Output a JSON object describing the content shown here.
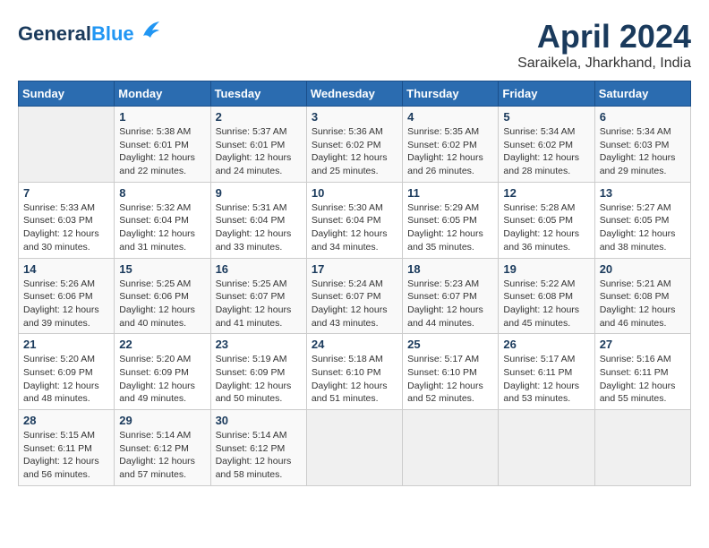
{
  "header": {
    "logo_text_general": "General",
    "logo_text_blue": "Blue",
    "month_year": "April 2024",
    "location": "Saraikela, Jharkhand, India"
  },
  "days_of_week": [
    "Sunday",
    "Monday",
    "Tuesday",
    "Wednesday",
    "Thursday",
    "Friday",
    "Saturday"
  ],
  "weeks": [
    [
      {
        "num": "",
        "info": ""
      },
      {
        "num": "1",
        "info": "Sunrise: 5:38 AM\nSunset: 6:01 PM\nDaylight: 12 hours\nand 22 minutes."
      },
      {
        "num": "2",
        "info": "Sunrise: 5:37 AM\nSunset: 6:01 PM\nDaylight: 12 hours\nand 24 minutes."
      },
      {
        "num": "3",
        "info": "Sunrise: 5:36 AM\nSunset: 6:02 PM\nDaylight: 12 hours\nand 25 minutes."
      },
      {
        "num": "4",
        "info": "Sunrise: 5:35 AM\nSunset: 6:02 PM\nDaylight: 12 hours\nand 26 minutes."
      },
      {
        "num": "5",
        "info": "Sunrise: 5:34 AM\nSunset: 6:02 PM\nDaylight: 12 hours\nand 28 minutes."
      },
      {
        "num": "6",
        "info": "Sunrise: 5:34 AM\nSunset: 6:03 PM\nDaylight: 12 hours\nand 29 minutes."
      }
    ],
    [
      {
        "num": "7",
        "info": "Sunrise: 5:33 AM\nSunset: 6:03 PM\nDaylight: 12 hours\nand 30 minutes."
      },
      {
        "num": "8",
        "info": "Sunrise: 5:32 AM\nSunset: 6:04 PM\nDaylight: 12 hours\nand 31 minutes."
      },
      {
        "num": "9",
        "info": "Sunrise: 5:31 AM\nSunset: 6:04 PM\nDaylight: 12 hours\nand 33 minutes."
      },
      {
        "num": "10",
        "info": "Sunrise: 5:30 AM\nSunset: 6:04 PM\nDaylight: 12 hours\nand 34 minutes."
      },
      {
        "num": "11",
        "info": "Sunrise: 5:29 AM\nSunset: 6:05 PM\nDaylight: 12 hours\nand 35 minutes."
      },
      {
        "num": "12",
        "info": "Sunrise: 5:28 AM\nSunset: 6:05 PM\nDaylight: 12 hours\nand 36 minutes."
      },
      {
        "num": "13",
        "info": "Sunrise: 5:27 AM\nSunset: 6:05 PM\nDaylight: 12 hours\nand 38 minutes."
      }
    ],
    [
      {
        "num": "14",
        "info": "Sunrise: 5:26 AM\nSunset: 6:06 PM\nDaylight: 12 hours\nand 39 minutes."
      },
      {
        "num": "15",
        "info": "Sunrise: 5:25 AM\nSunset: 6:06 PM\nDaylight: 12 hours\nand 40 minutes."
      },
      {
        "num": "16",
        "info": "Sunrise: 5:25 AM\nSunset: 6:07 PM\nDaylight: 12 hours\nand 41 minutes."
      },
      {
        "num": "17",
        "info": "Sunrise: 5:24 AM\nSunset: 6:07 PM\nDaylight: 12 hours\nand 43 minutes."
      },
      {
        "num": "18",
        "info": "Sunrise: 5:23 AM\nSunset: 6:07 PM\nDaylight: 12 hours\nand 44 minutes."
      },
      {
        "num": "19",
        "info": "Sunrise: 5:22 AM\nSunset: 6:08 PM\nDaylight: 12 hours\nand 45 minutes."
      },
      {
        "num": "20",
        "info": "Sunrise: 5:21 AM\nSunset: 6:08 PM\nDaylight: 12 hours\nand 46 minutes."
      }
    ],
    [
      {
        "num": "21",
        "info": "Sunrise: 5:20 AM\nSunset: 6:09 PM\nDaylight: 12 hours\nand 48 minutes."
      },
      {
        "num": "22",
        "info": "Sunrise: 5:20 AM\nSunset: 6:09 PM\nDaylight: 12 hours\nand 49 minutes."
      },
      {
        "num": "23",
        "info": "Sunrise: 5:19 AM\nSunset: 6:09 PM\nDaylight: 12 hours\nand 50 minutes."
      },
      {
        "num": "24",
        "info": "Sunrise: 5:18 AM\nSunset: 6:10 PM\nDaylight: 12 hours\nand 51 minutes."
      },
      {
        "num": "25",
        "info": "Sunrise: 5:17 AM\nSunset: 6:10 PM\nDaylight: 12 hours\nand 52 minutes."
      },
      {
        "num": "26",
        "info": "Sunrise: 5:17 AM\nSunset: 6:11 PM\nDaylight: 12 hours\nand 53 minutes."
      },
      {
        "num": "27",
        "info": "Sunrise: 5:16 AM\nSunset: 6:11 PM\nDaylight: 12 hours\nand 55 minutes."
      }
    ],
    [
      {
        "num": "28",
        "info": "Sunrise: 5:15 AM\nSunset: 6:11 PM\nDaylight: 12 hours\nand 56 minutes."
      },
      {
        "num": "29",
        "info": "Sunrise: 5:14 AM\nSunset: 6:12 PM\nDaylight: 12 hours\nand 57 minutes."
      },
      {
        "num": "30",
        "info": "Sunrise: 5:14 AM\nSunset: 6:12 PM\nDaylight: 12 hours\nand 58 minutes."
      },
      {
        "num": "",
        "info": ""
      },
      {
        "num": "",
        "info": ""
      },
      {
        "num": "",
        "info": ""
      },
      {
        "num": "",
        "info": ""
      }
    ]
  ]
}
